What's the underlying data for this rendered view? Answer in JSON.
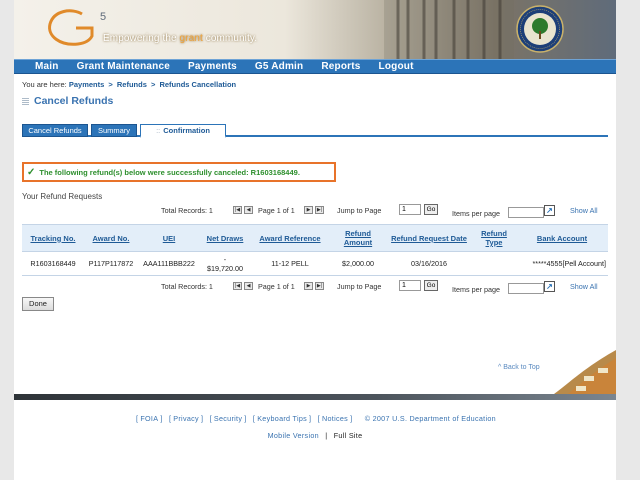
{
  "header": {
    "logo_superscript": "5",
    "tagline_before": "Empowering the ",
    "tagline_highlight": "grant",
    "tagline_after": " community."
  },
  "nav": {
    "items": [
      "Main",
      "Grant Maintenance",
      "Payments",
      "G5 Admin",
      "Reports",
      "Logout"
    ]
  },
  "breadcrumb": {
    "prefix": "You are here:",
    "items": [
      "Payments",
      "Refunds",
      "Refunds Cancellation"
    ],
    "separator": ">"
  },
  "page_title": "Cancel Refunds",
  "tabs": [
    {
      "label": "Cancel Refunds",
      "active": false
    },
    {
      "label": "Summary",
      "active": false
    },
    {
      "label": "Confirmation",
      "active": true
    }
  ],
  "success_message": "The following refund(s) below were successfully canceled: R1603168449.",
  "requests_label": "Your Refund Requests",
  "pager": {
    "total_records": "Total Records: 1",
    "page_info": "Page 1 of 1",
    "jump_label": "Jump to Page",
    "jump_value": "1",
    "go_label": "Go",
    "items_per_page_label": "Items per page",
    "show_all": "Show All"
  },
  "table": {
    "headers": [
      "Tracking No.",
      "Award No.",
      "UEI",
      "Net Draws",
      "Award Reference",
      "Refund Amount",
      "Refund Request Date",
      "Refund Type",
      "Bank Account"
    ],
    "rows": [
      {
        "tracking_no": "R1603168449",
        "award_no": "P117P117872",
        "uei": "AAA111BBB222",
        "net_draws_line1": "-",
        "net_draws_line2": "$19,720.00",
        "award_reference": "11-12 PELL",
        "refund_amount": "$2,000.00",
        "refund_request_date": "03/16/2016",
        "refund_type": "",
        "bank_account": "*****4555[Pell Account]"
      }
    ]
  },
  "done_button": "Done",
  "back_to_top": "^ Back to Top",
  "footer": {
    "links": [
      "FOIA",
      "Privacy",
      "Security",
      "Keyboard Tips",
      "Notices"
    ],
    "copyright": "©  2007  U.S.  Department  of  Education",
    "mobile_version": "Mobile  Version",
    "divider": "|",
    "full_site": "Full  Site"
  },
  "colors": {
    "nav_blue": "#2c74b8",
    "success_green": "#2d8f2d",
    "success_border": "#e8732a",
    "link_blue": "#3a73b0"
  }
}
